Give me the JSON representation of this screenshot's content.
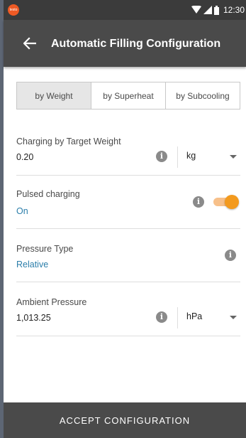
{
  "status_bar": {
    "logo_text": "testo",
    "time": "12:30",
    "icons": [
      "wifi-icon",
      "signal-icon",
      "battery-icon"
    ]
  },
  "app_bar": {
    "back_icon": "arrow-left-icon",
    "title": "Automatic Filling Configuration"
  },
  "tabs": [
    {
      "label": "by Weight",
      "active": true
    },
    {
      "label": "by Superheat",
      "active": false
    },
    {
      "label": "by Subcooling",
      "active": false
    }
  ],
  "fields": {
    "target_weight": {
      "label": "Charging by Target Weight",
      "value": "0.20",
      "unit": "kg"
    },
    "pulsed_charging": {
      "label": "Pulsed charging",
      "value": "On",
      "toggle_on": true
    },
    "pressure_type": {
      "label": "Pressure Type",
      "value": "Relative"
    },
    "ambient_pressure": {
      "label": "Ambient Pressure",
      "value": "1,013.25",
      "unit": "hPa"
    }
  },
  "info_glyph": "i",
  "accept_button": "ACCEPT CONFIGURATION",
  "colors": {
    "app_bar": "#4a4a4a",
    "status_bar": "#3b3b3b",
    "link_value": "#2b7eaa",
    "toggle_accent": "#f39a1e",
    "active_tab": "#e6e6e6"
  }
}
